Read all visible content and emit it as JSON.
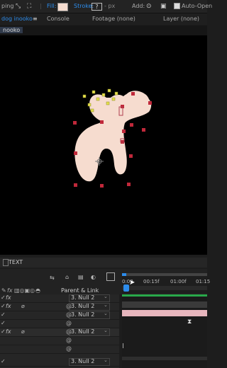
{
  "toolbar": {
    "snapping_partial": "ping",
    "fill_label": "Fill:",
    "stroke_label": "Stroke:",
    "stroke_value": "?",
    "px_label": "- px",
    "add_label": "Add:",
    "auto_open_label": "Auto-Open",
    "fill_color": "#f6dccf"
  },
  "tabs": {
    "composition": "dog inooko",
    "menu_icon": "≡",
    "console": "Console",
    "footage": "Footage (none)",
    "layer": "Layer (none)"
  },
  "breadcrumb": {
    "label": "nooko"
  },
  "viewer": {
    "shape_color": "#f6dccf",
    "handle_color": "#c0283a",
    "puppet_color": "#e6e04a"
  },
  "timeline": {
    "header_label": "TEXT",
    "parent_link_label": "Parent & Link",
    "time_ticks": [
      "0:00",
      "00:15f",
      "01:00f",
      "01:15"
    ],
    "rows": [
      {
        "parent": "3. Null 2",
        "has_fx": true
      },
      {
        "parent": "3. Null 2",
        "has_fx": true
      },
      {
        "parent": "3. Null 2",
        "has_fx": false
      },
      {
        "parent": "3. Null 2",
        "has_fx": true
      },
      {
        "parent": "3. Null 2",
        "has_fx": false
      },
      {
        "parent": "3. Null 2",
        "has_fx": false
      }
    ],
    "bar_color": "#e7b6bd",
    "green_bar_color": "#29a84a",
    "playhead_color": "#2d8ceb"
  }
}
